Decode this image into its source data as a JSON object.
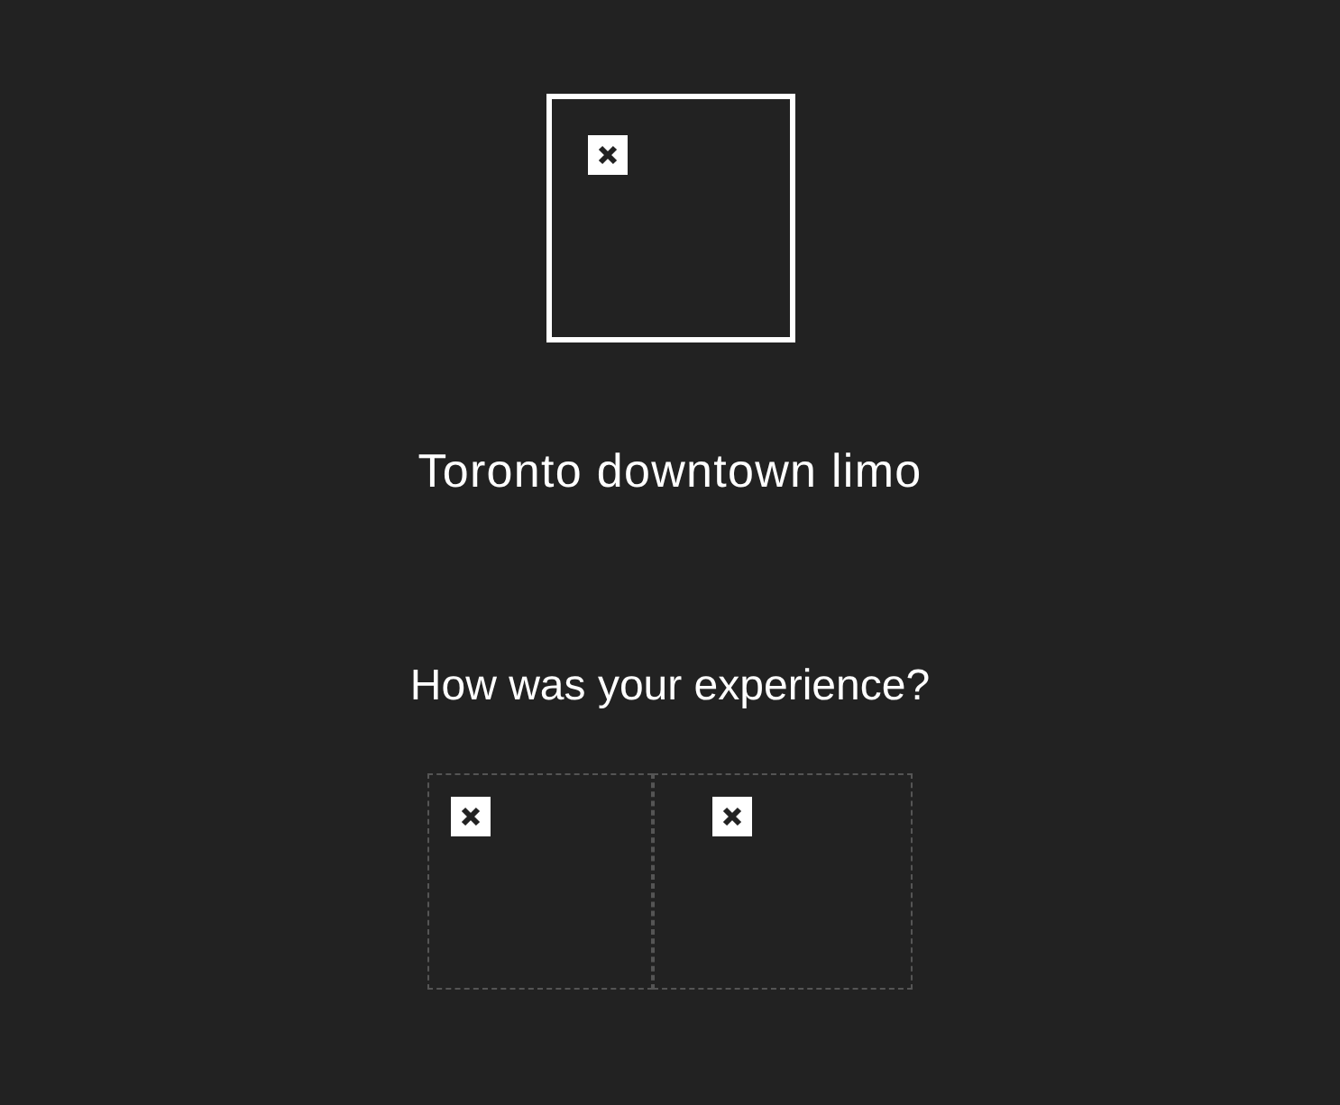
{
  "brand": {
    "name": "Toronto downtown limo"
  },
  "prompt": "How was your experience?"
}
